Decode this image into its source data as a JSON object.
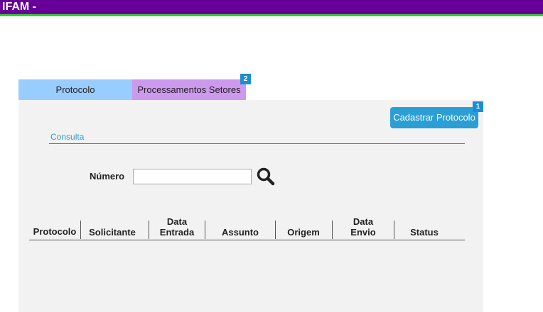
{
  "header": {
    "title": "IFAM -"
  },
  "tabs": [
    {
      "label": "Protocolo"
    },
    {
      "label": "Processamentos Setores",
      "badge": "2"
    }
  ],
  "actions": {
    "cadastrar_label": "Cadastrar Protocolo",
    "cadastrar_badge": "1"
  },
  "consulta": {
    "title": "Consulta",
    "numero_label": "Número",
    "numero_value": "",
    "numero_placeholder": ""
  },
  "table": {
    "columns": [
      {
        "line1": "",
        "line2": "Protocolo"
      },
      {
        "line1": "",
        "line2": "Solicitante"
      },
      {
        "line1": "Data",
        "line2": "Entrada"
      },
      {
        "line1": "",
        "line2": "Assunto"
      },
      {
        "line1": "",
        "line2": "Origem"
      },
      {
        "line1": "Data",
        "line2": "Envio"
      },
      {
        "line1": "",
        "line2": "Status"
      }
    ],
    "rows": []
  },
  "colors": {
    "header_bg": "#660099",
    "header_accent": "#33cc33",
    "tab_protocolo_bg": "#99ccff",
    "tab_process_bg": "#cc99ee",
    "button_bg": "#2a9fd6",
    "badge_bg": "#1a8fcf",
    "panel_bg": "#f2f2f2"
  }
}
